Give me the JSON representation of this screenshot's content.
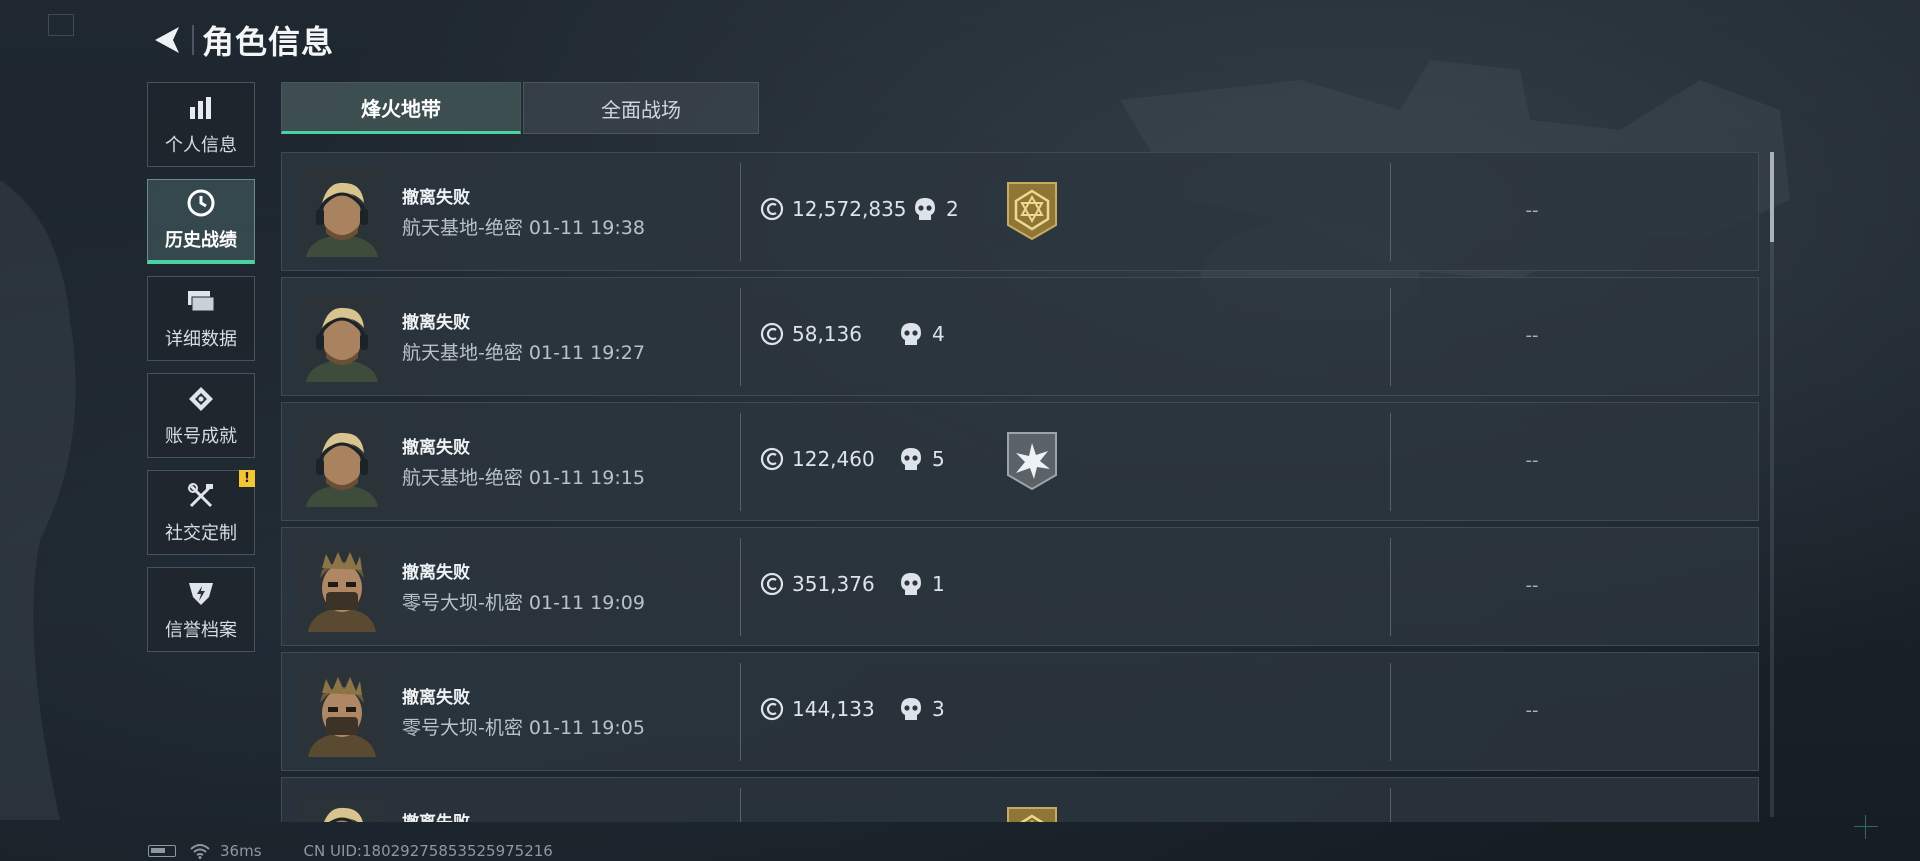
{
  "header": {
    "title": "角色信息"
  },
  "sidebar": {
    "items": [
      {
        "label": "个人信息",
        "icon": "bar-chart-icon"
      },
      {
        "label": "历史战绩",
        "icon": "clock-icon",
        "active": true
      },
      {
        "label": "详细数据",
        "icon": "cards-icon"
      },
      {
        "label": "账号成就",
        "icon": "badge-icon"
      },
      {
        "label": "社交定制",
        "icon": "tools-icon",
        "badge": "!"
      },
      {
        "label": "信誉档案",
        "icon": "shield-bolt-icon"
      }
    ]
  },
  "tabs": [
    {
      "label": "烽火地带",
      "active": true
    },
    {
      "label": "全面战场"
    }
  ],
  "records": [
    {
      "status": "撤离失败",
      "map": "航天基地-绝密",
      "time": "01-11 19:38",
      "coins": "12,572,835",
      "kills": "2",
      "medal": "gold-hex-medal",
      "extra": "--"
    },
    {
      "status": "撤离失败",
      "map": "航天基地-绝密",
      "time": "01-11 19:27",
      "coins": "58,136",
      "kills": "4",
      "medal": "",
      "extra": "--"
    },
    {
      "status": "撤离失败",
      "map": "航天基地-绝密",
      "time": "01-11 19:15",
      "coins": "122,460",
      "kills": "5",
      "medal": "silver-burst-medal",
      "extra": "--"
    },
    {
      "status": "撤离失败",
      "map": "零号大坝-机密",
      "time": "01-11 19:09",
      "coins": "351,376",
      "kills": "1",
      "medal": "",
      "extra": "--"
    },
    {
      "status": "撤离失败",
      "map": "零号大坝-机密",
      "time": "01-11 19:05",
      "coins": "144,133",
      "kills": "3",
      "medal": "",
      "extra": "--"
    },
    {
      "status": "撤离失败",
      "map": "",
      "time": "",
      "coins": "",
      "kills": "",
      "medal": "gold-hex-medal",
      "extra": ""
    }
  ],
  "footer": {
    "ping": "36ms",
    "uid": "CN UID:1802927585352597521​6"
  },
  "colors": {
    "accent": "#4cd1a2",
    "gold": "#b89a4a",
    "alert": "#f2c531"
  }
}
